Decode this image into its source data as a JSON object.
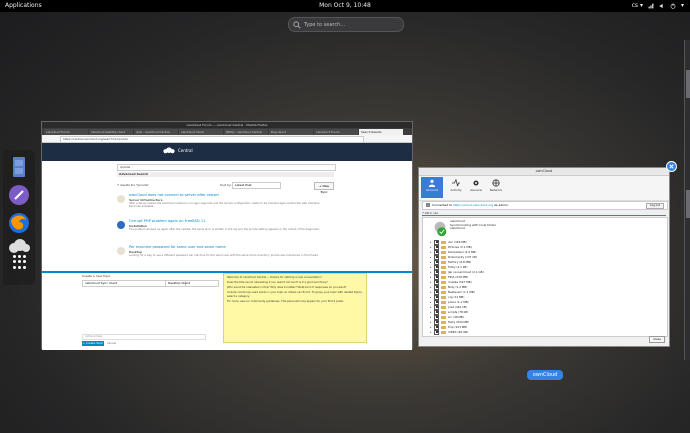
{
  "topbar": {
    "applications": "Applications",
    "clock": "Mon Oct  9, 10:48",
    "lang": "cs",
    "lang_arrow": "▾",
    "power_arrow": "▾"
  },
  "search": {
    "placeholder": "Type to search…"
  },
  "firefox": {
    "title": "ownCloud Forum — ownCloud Central - Mozilla Firefox",
    "tabs": [
      "ownCloud Forum",
      "owncloud desktop client",
      "ipv6 - ownCloud Central",
      "ownCloud Client",
      "[BUG] - ownCloud Central",
      "Bug report",
      "ownCloud Forum",
      "Search Results"
    ],
    "url": "https://central.owncloud.org/search?q=ipnode",
    "forum_title": "Central",
    "search_value": "ipnode",
    "advanced_search": "Advanced Search",
    "found_text": "7 results for \"ipnode\"",
    "sort_by": "Sort by:",
    "sort_value": "Latest Post",
    "new_topic": "+ New Topic",
    "results": [
      {
        "title": "ownCloud does not connect to server after restart",
        "meta": "Server Infrastructure",
        "snippet": "After a server restart the ownCloud instance no longer responds and the ipnode configuration needs to be checked again before the web interface becomes available."
      },
      {
        "title": "Corrupt PHP problem again on FreeBSD 11",
        "meta": "Installation",
        "snippet": "The problem showed up again after the update; the same error is written in the log and the ipnode setting appears in the output of the diagnostic."
      },
      {
        "title": "Per machine password for same user and same home",
        "meta": "Desktop",
        "snippet": "Looking for a way to use a different password per machine for the same user with the same home directory; ipnode was mentioned in the thread."
      }
    ],
    "composer": {
      "label": "Create a new Topic",
      "title_value": "ownCloud Sync client",
      "category_value": "Desktop Client",
      "tags_placeholder": "optional tags",
      "create_button": "+ Create Topic",
      "cancel": "cancel"
    },
    "tip": {
      "header": "Welcome to ownCloud Central — thanks for starting a new conversation!",
      "bullets": [
        "Does the title sound interesting if you read it out loud? Is it a good summary?",
        "Who would be interested in this? Why does it matter? What kind of responses do you want?",
        "Include commonly used words in your topic so others can find it. To group your topic with related topics, select a category."
      ],
      "footer": "For more, see our community guidelines. This panel will only appear for your first 2 posts."
    }
  },
  "owncloud": {
    "title": "ownCloud",
    "toolbar": [
      {
        "label": "Account",
        "icon": "account-icon"
      },
      {
        "label": "Activity",
        "icon": "activity-icon"
      },
      {
        "label": "General",
        "icon": "gear-icon"
      },
      {
        "label": "Network",
        "icon": "network-icon"
      }
    ],
    "connected_prefix": "Connected to",
    "connected_url": "https://cloud.owncloud.org",
    "connected_suffix": "as admin.",
    "logout": "Log out",
    "used": "7 GB in use",
    "account_name": "ownCloud",
    "account_line1": "Synchronizing with local folder",
    "account_line2": "ownCloud",
    "folders": [
      "doc (346 MB)",
      "Pictures (2.1 MB)",
      "Kompetenz (2.0 MB)",
      "Dokumenty (137 kB)",
      "Faktury (6.8 MB)",
      "Fotky (2.1 kB)",
      "Jak na ownCloud (2.1 GB)",
      "FIDA (230 MB)",
      "muzika (527 MB)",
      "Noty (1.2 MB)",
      "Nastavení (1.1 MB)",
      "org (12 MB)",
      "prace (1.1 MB)",
      "prez (461 kB)",
      "scripts (78 kB)",
      "src (48 MB)",
      "Texty (844 MB)",
      "tmp (223 MB)",
      "VIDEA (96 GB)"
    ],
    "close": "Close",
    "window_label": "ownCloud"
  },
  "colors": {
    "accent": "#3584e4",
    "forum_header": "#1d2d44",
    "tip": "#fff9a6",
    "link": "#0088cc"
  }
}
